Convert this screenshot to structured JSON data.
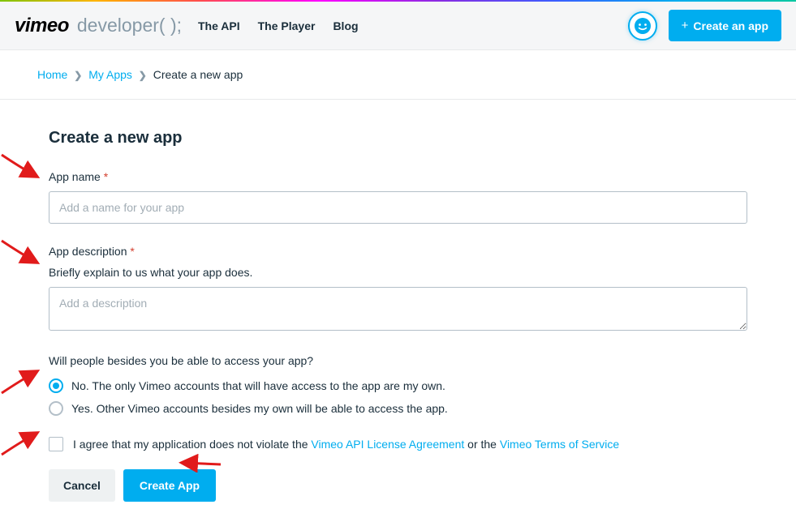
{
  "header": {
    "logo_text": "vimeo",
    "developer_tag": "developer( );",
    "nav": [
      {
        "label": "The API"
      },
      {
        "label": "The Player"
      },
      {
        "label": "Blog"
      }
    ],
    "create_button": "Create an app"
  },
  "breadcrumb": {
    "items": [
      {
        "label": "Home",
        "link": true
      },
      {
        "label": "My Apps",
        "link": true
      },
      {
        "label": "Create a new app",
        "link": false
      }
    ]
  },
  "page": {
    "title": "Create a new app",
    "app_name_label": "App name",
    "app_name_placeholder": "Add a name for your app",
    "app_desc_label": "App description",
    "app_desc_hint": "Briefly explain to us what your app does.",
    "app_desc_placeholder": "Add a description",
    "access_question": "Will people besides you be able to access your app?",
    "access_options": [
      {
        "label": "No. The only Vimeo accounts that will have access to the app are my own.",
        "checked": true
      },
      {
        "label": "Yes. Other Vimeo accounts besides my own will be able to access the app.",
        "checked": false
      }
    ],
    "agree_prefix": "I agree that my application does not violate the ",
    "agree_link1": "Vimeo API License Agreement",
    "agree_mid": " or the ",
    "agree_link2": "Vimeo Terms of Service",
    "cancel_label": "Cancel",
    "submit_label": "Create App"
  },
  "colors": {
    "accent": "#00adef",
    "required": "#d43f2e",
    "arrow": "#e11b1b"
  }
}
